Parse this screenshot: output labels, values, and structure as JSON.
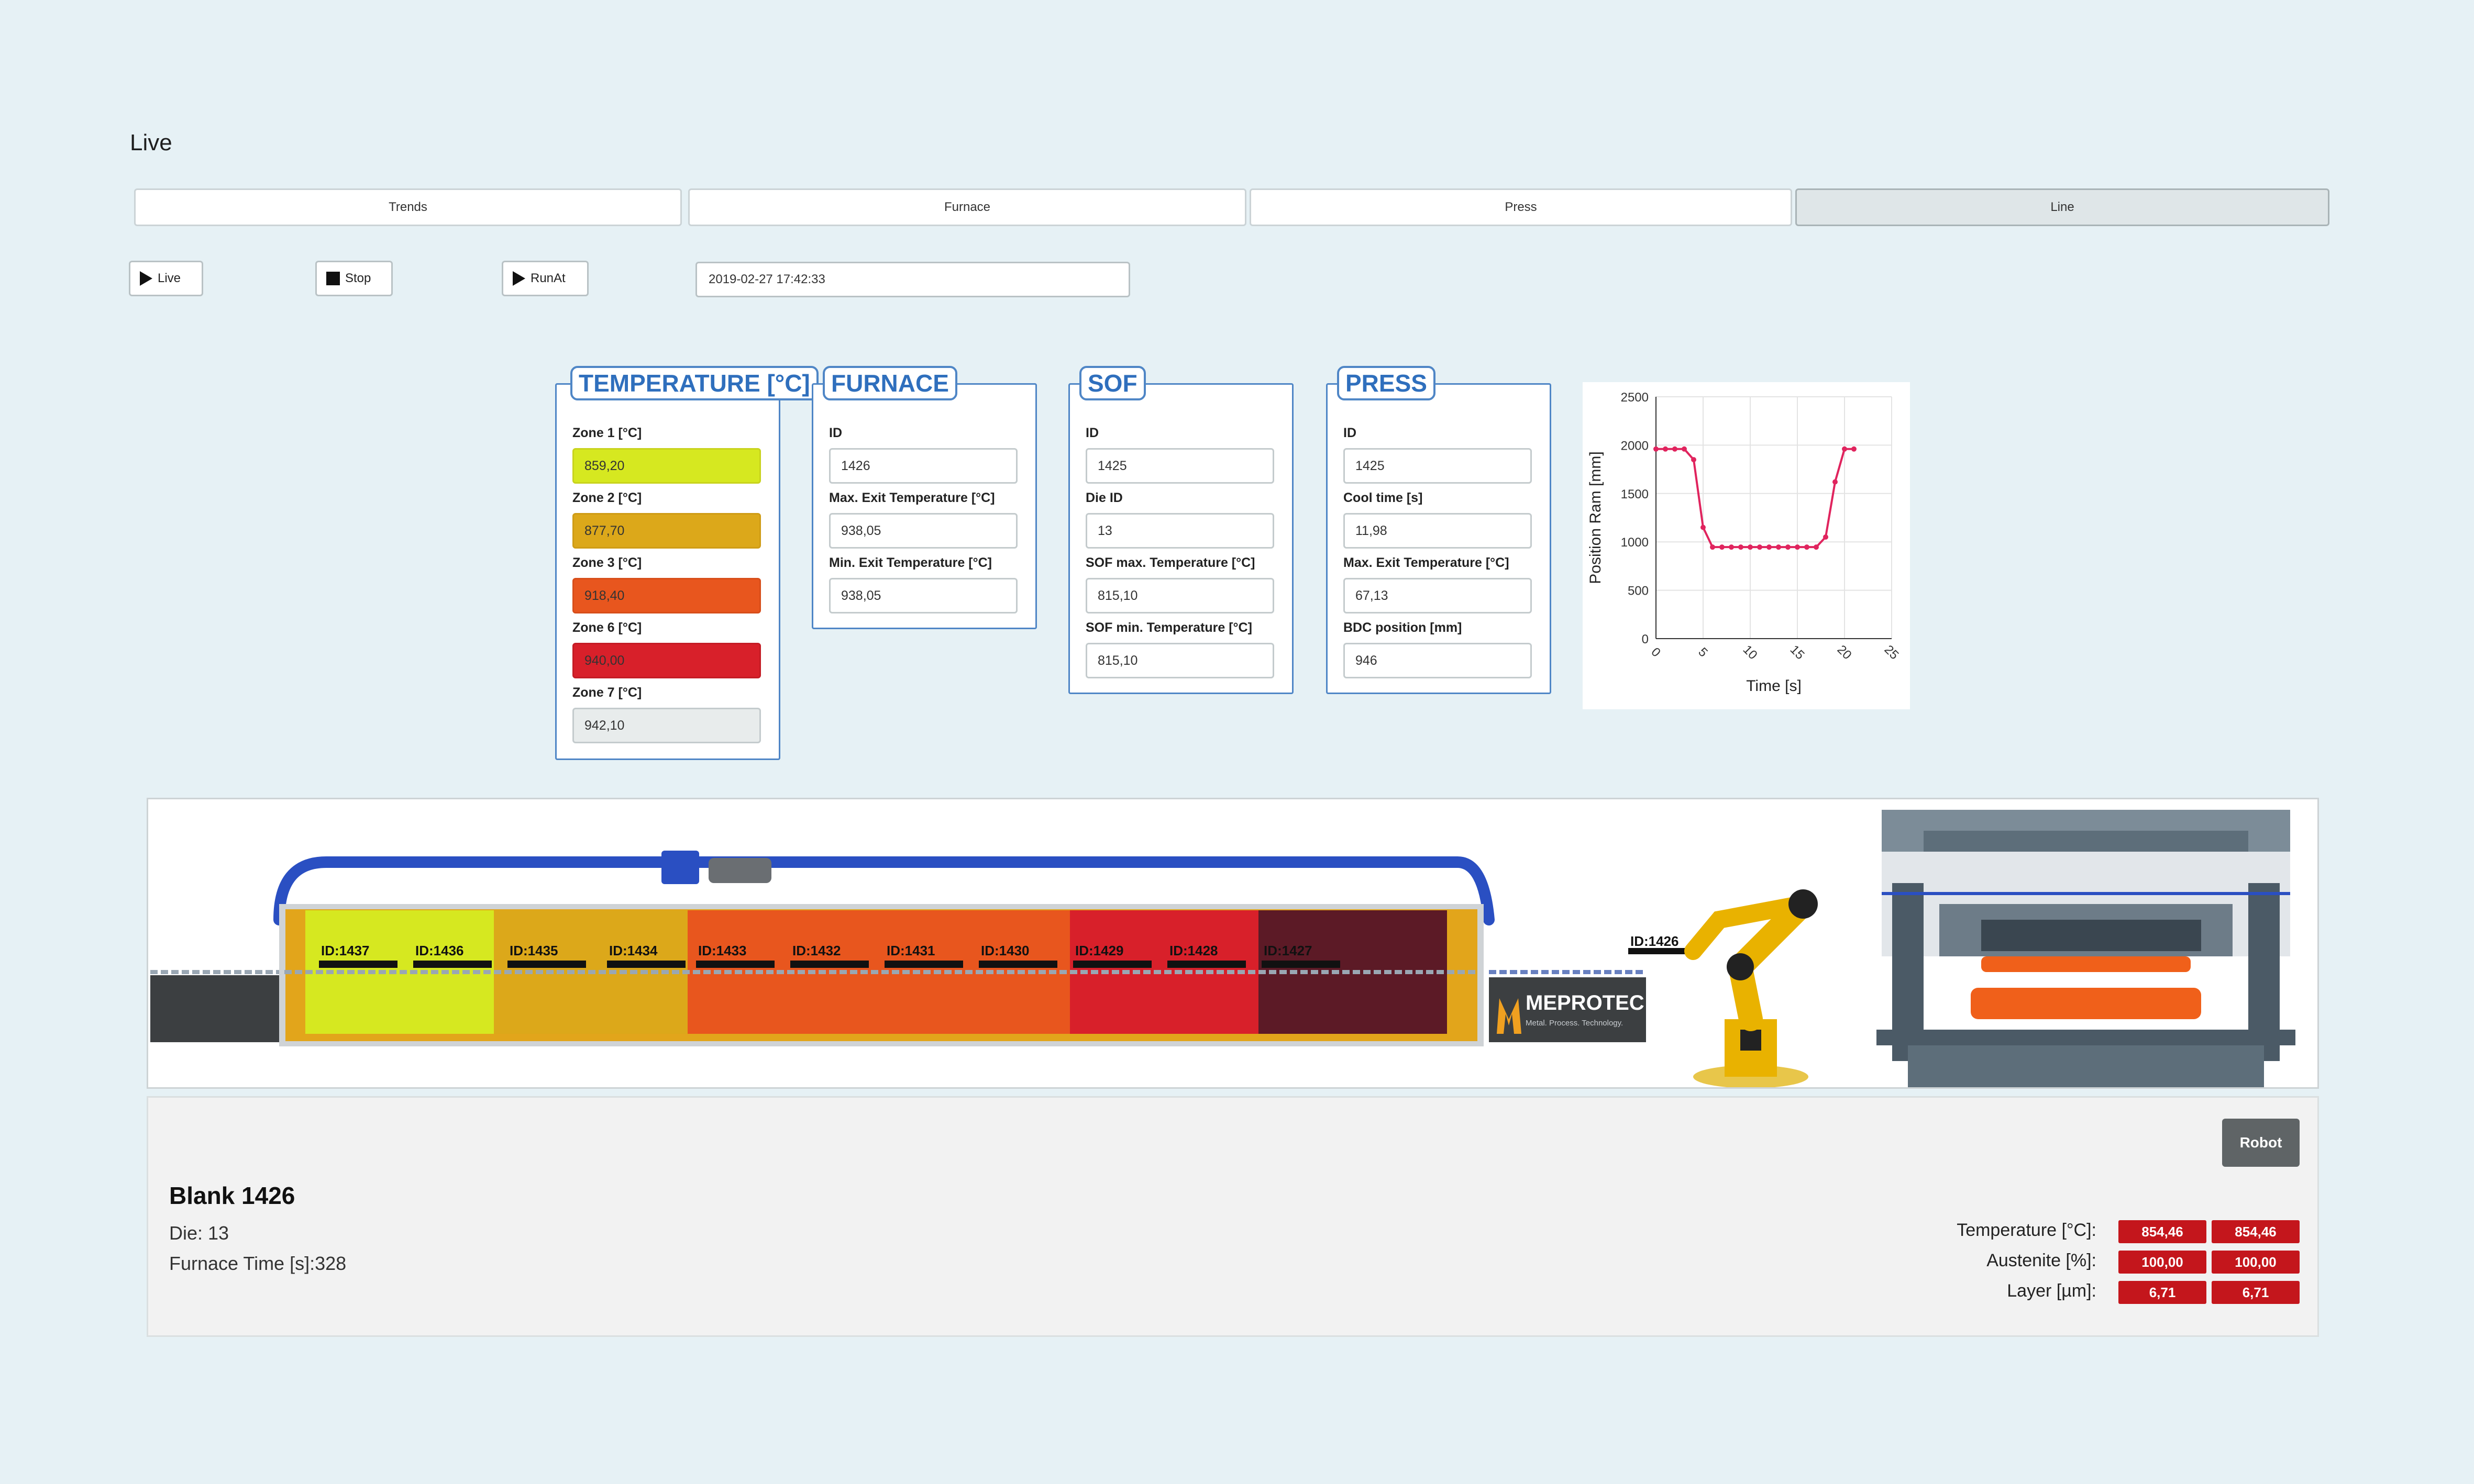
{
  "page": {
    "title": "Live"
  },
  "tabs": [
    {
      "label": "Trends"
    },
    {
      "label": "Furnace"
    },
    {
      "label": "Press"
    },
    {
      "label": "Line"
    }
  ],
  "controls": {
    "live_label": "Live",
    "stop_label": "Stop",
    "runat_label": "RunAt",
    "datetime": "2019-02-27 17:42:33"
  },
  "temperature_panel": {
    "title": "TEMPERATURE [°C]",
    "zones": [
      {
        "label": "Zone 1 [°C]",
        "value": "859,20",
        "color": "#d6e820"
      },
      {
        "label": "Zone 2 [°C]",
        "value": "877,70",
        "color": "#dca81a"
      },
      {
        "label": "Zone 3 [°C]",
        "value": "918,40",
        "color": "#e8561e"
      },
      {
        "label": "Zone 6 [°C]",
        "value": "940,00",
        "color": "#d8202a"
      },
      {
        "label": "Zone 7 [°C]",
        "value": "942,10",
        "color": "#e8ecec"
      }
    ]
  },
  "furnace_panel": {
    "title": "FURNACE",
    "fields": [
      {
        "label": "ID",
        "value": "1426"
      },
      {
        "label": "Max. Exit Temperature [°C]",
        "value": "938,05"
      },
      {
        "label": "Min. Exit Temperature [°C]",
        "value": "938,05"
      }
    ]
  },
  "sof_panel": {
    "title": "SOF",
    "fields": [
      {
        "label": "ID",
        "value": "1425"
      },
      {
        "label": "Die ID",
        "value": "13"
      },
      {
        "label": "SOF max. Temperature [°C]",
        "value": "815,10"
      },
      {
        "label": "SOF min. Temperature [°C]",
        "value": "815,10"
      }
    ]
  },
  "press_panel": {
    "title": "PRESS",
    "fields": [
      {
        "label": "ID",
        "value": "1425"
      },
      {
        "label": "Cool time [s]",
        "value": "11,98"
      },
      {
        "label": "Max. Exit Temperature [°C]",
        "value": "67,13"
      },
      {
        "label": "BDC position [mm]",
        "value": "946"
      }
    ]
  },
  "chart_data": {
    "type": "line",
    "xlabel": "Time [s]",
    "ylabel": "Position Ram [mm]",
    "xlim": [
      0,
      25
    ],
    "ylim": [
      0,
      2500
    ],
    "xticks": [
      "0",
      "5",
      "10",
      "15",
      "20",
      "25"
    ],
    "yticks": [
      "0",
      "500",
      "1000",
      "1500",
      "2000",
      "2500"
    ],
    "grid": true,
    "color": "#e0245e",
    "x": [
      0,
      1,
      2,
      3,
      4,
      5,
      6,
      7,
      8,
      9,
      10,
      11,
      12,
      13,
      14,
      15,
      16,
      17,
      18,
      19,
      20,
      21
    ],
    "y": [
      1960,
      1960,
      1960,
      1960,
      1850,
      1150,
      946,
      946,
      946,
      946,
      946,
      946,
      946,
      946,
      946,
      946,
      946,
      946,
      1050,
      1620,
      1960,
      1960
    ]
  },
  "line_view": {
    "furnace_ids": [
      "ID:1437",
      "ID:1436",
      "ID:1435",
      "ID:1434",
      "ID:1433",
      "ID:1432",
      "ID:1431",
      "ID:1430",
      "ID:1429",
      "ID:1428",
      "ID:1427"
    ],
    "robot_id": "ID:1426",
    "logo_text": "MEPROTEC",
    "logo_subtext": "Metal. Process. Technology."
  },
  "blank": {
    "title": "Blank 1426",
    "die": "Die: 13",
    "furnace_time": "Furnace Time [s]:328",
    "robot_label": "Robot",
    "metrics": [
      {
        "label": "Temperature [°C]:",
        "v1": "854,46",
        "v2": "854,46"
      },
      {
        "label": "Austenite [%]:",
        "v1": "100,00",
        "v2": "100,00"
      },
      {
        "label": "Layer [µm]:",
        "v1": "6,71",
        "v2": "6,71"
      }
    ]
  }
}
